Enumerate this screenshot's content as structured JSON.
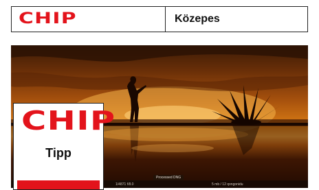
{
  "rating": {
    "logo": "CHIP",
    "label": "Közepes"
  },
  "photo": {
    "overlay_label": "Processed DNG",
    "status_left": "1/4871   f/8.0",
    "status_mid": "5 mb / 12 qongonidu"
  },
  "badge": {
    "logo": "CHIP",
    "label": "Tipp"
  },
  "colors": {
    "brand_red": "#e3131b"
  }
}
